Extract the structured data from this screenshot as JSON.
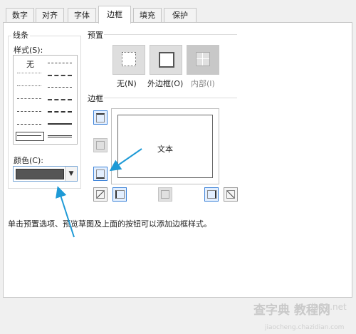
{
  "tabs": [
    {
      "label": "数字"
    },
    {
      "label": "对齐"
    },
    {
      "label": "字体"
    },
    {
      "label": "边框"
    },
    {
      "label": "填充"
    },
    {
      "label": "保护"
    }
  ],
  "active_tab": "边框",
  "line_group": {
    "title": "线条",
    "style_label": "样式(S):",
    "none_label": "无",
    "color_label": "颜色(C):",
    "color_value": "#555555"
  },
  "preset_group": {
    "title": "预置",
    "presets": [
      {
        "label": "无(N)",
        "enabled": true
      },
      {
        "label": "外边框(O)",
        "enabled": true
      },
      {
        "label": "内部(I)",
        "enabled": false
      }
    ]
  },
  "border_group": {
    "title": "边框",
    "preview_text": "文本"
  },
  "hint_text": "单击预置选项、预览草图及上面的按钮可以添加边框样式。",
  "watermark": {
    "line1": "查字典",
    "line2": "教程网",
    "site": "jb51.net",
    "url": "jiaocheng.chazidian.com"
  },
  "colors": {
    "accent": "#3c82d8",
    "arrow": "#1e9ad6"
  }
}
